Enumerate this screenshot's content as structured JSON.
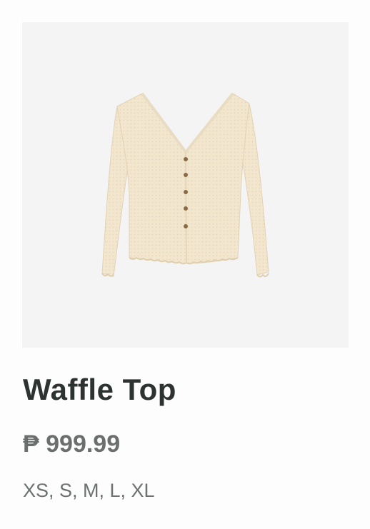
{
  "product": {
    "name": "Waffle Top",
    "price": "₱ 999.99",
    "sizes": "XS, S, M, L, XL",
    "image_bg_color": "#f4f4f4",
    "garment_color": "#f2e6cf"
  }
}
